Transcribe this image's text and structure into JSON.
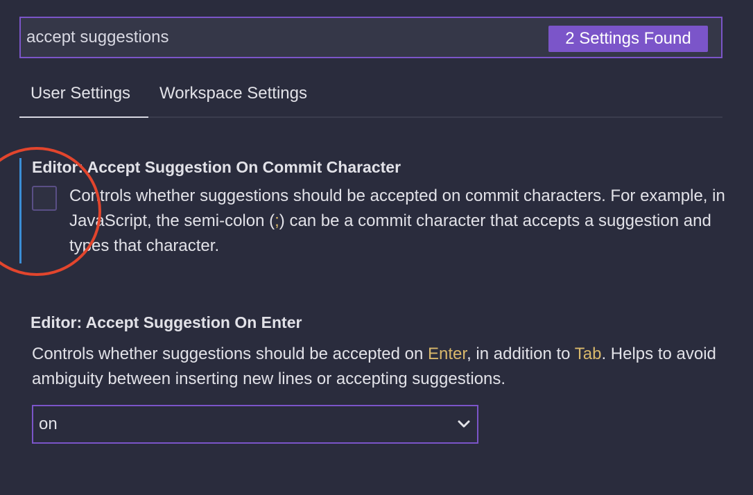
{
  "search": {
    "value": "accept suggestions",
    "found_badge": "2 Settings Found"
  },
  "tabs": [
    {
      "label": "User Settings",
      "active": true
    },
    {
      "label": "Workspace Settings",
      "active": false
    }
  ],
  "settings": [
    {
      "title": "Editor: Accept Suggestion On Commit Character",
      "control": "checkbox",
      "checked": false,
      "description": "Controls whether suggestions should be accepted on commit characters. For example, in JavaScript, the semi-colon (;) can be a commit character that accepts a suggestion and types that character.",
      "desc_before": "Controls whether suggestions should be accepted on commit characters. For example, in JavaScript, the semi-colon (",
      "desc_code": ";",
      "desc_after": ") can be a commit character that accepts a suggestion and types that character."
    },
    {
      "title": "Editor: Accept Suggestion On Enter",
      "control": "select",
      "desc_part1": "Controls whether suggestions should be accepted on ",
      "desc_key1": "Enter",
      "desc_part2": ", in addition to ",
      "desc_key2": "Tab",
      "desc_part3": ". Helps to avoid ambiguity between inserting new lines or accepting suggestions.",
      "selected_value": "on"
    }
  ],
  "colors": {
    "background": "#2a2c3d",
    "accent": "#7b55c9",
    "highlight": "#d9b86b",
    "modified_indicator": "#3b8ed6",
    "annotation_circle": "#e2452d"
  },
  "icons": {
    "dropdown": "chevron-down-icon"
  }
}
